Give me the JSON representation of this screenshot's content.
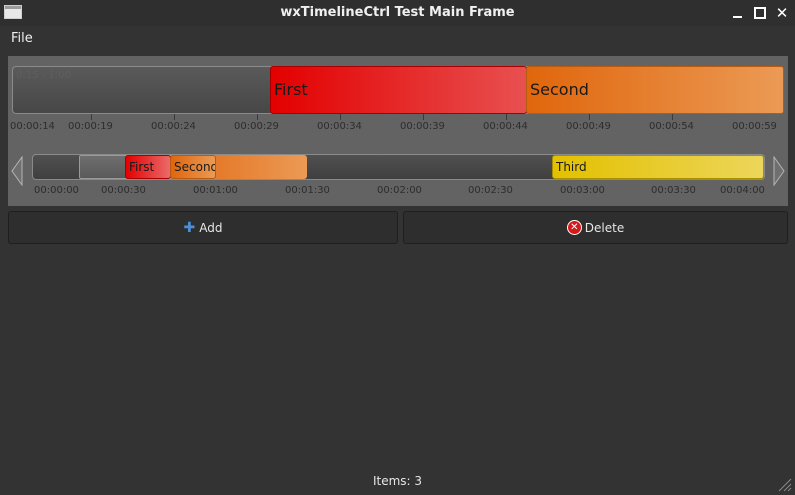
{
  "window": {
    "title": "wxTimelineCtrl Test Main Frame",
    "minimize": "–",
    "close": "✕"
  },
  "menu": {
    "file": "File"
  },
  "zoom": {
    "range_label": "0:15 - 1:00",
    "items": [
      {
        "label": "First",
        "color": "#e30000"
      },
      {
        "label": "Second",
        "color": "#e0660c"
      }
    ],
    "ticks": [
      "00:00:14",
      "00:00:19",
      "00:00:24",
      "00:00:29",
      "00:00:34",
      "00:00:39",
      "00:00:44",
      "00:00:49",
      "00:00:54",
      "00:00:59"
    ]
  },
  "overview": {
    "items": [
      {
        "label": "First",
        "color": "#e30000"
      },
      {
        "label": "Second",
        "color": "#e0660c"
      },
      {
        "label": "Third",
        "color": "#e3c000"
      }
    ],
    "ticks": [
      "00:00:00",
      "00:00:30",
      "00:01:00",
      "00:01:30",
      "00:02:00",
      "00:02:30",
      "00:03:00",
      "00:03:30",
      "00:04:00"
    ]
  },
  "buttons": {
    "add": "Add",
    "delete": "Delete",
    "delete_glyph": "✕",
    "add_glyph": "✚"
  },
  "status": {
    "items": "Items: 3"
  }
}
